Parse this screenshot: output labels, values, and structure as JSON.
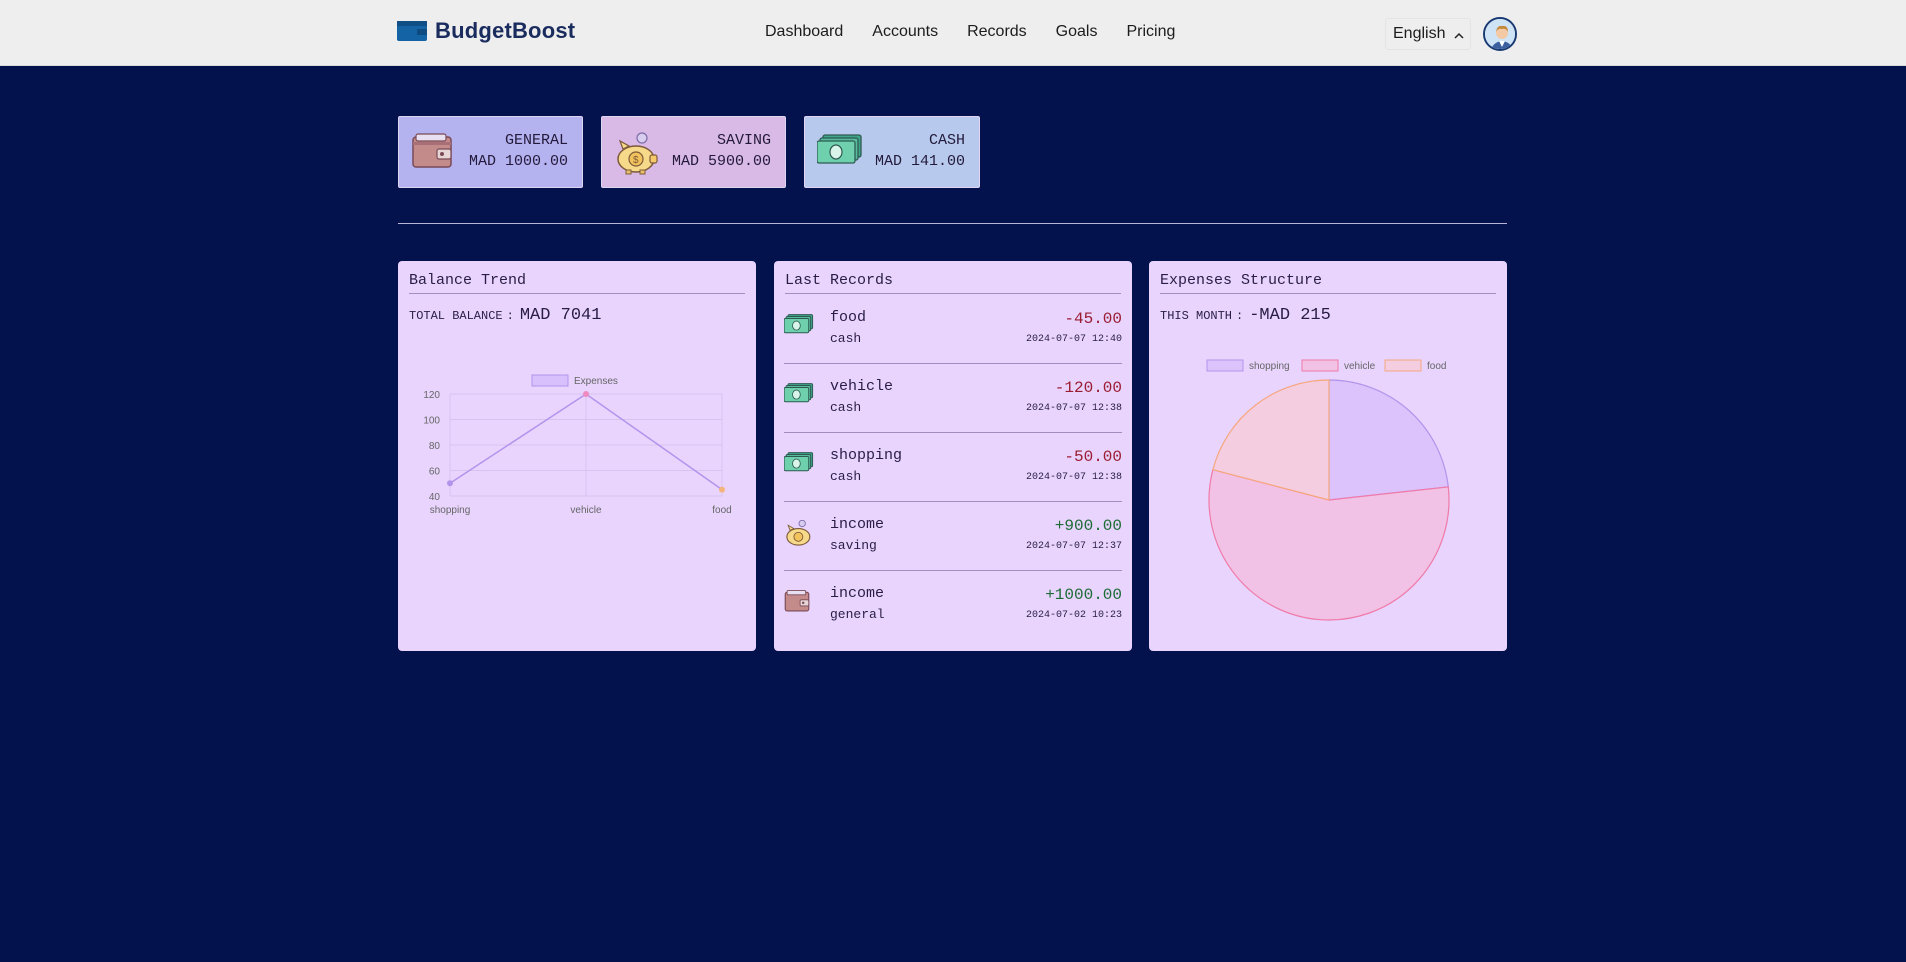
{
  "header": {
    "brand": "BudgetBoost",
    "nav": [
      "Dashboard",
      "Accounts",
      "Records",
      "Goals",
      "Pricing"
    ],
    "language": "English"
  },
  "accounts": [
    {
      "name": "GENERAL",
      "amount": "MAD 1000.00",
      "icon": "wallet-icon",
      "color": "#b5b3ef"
    },
    {
      "name": "SAVING",
      "amount": "MAD 5900.00",
      "icon": "piggy-bank-icon",
      "color": "#d9b9e6"
    },
    {
      "name": "CASH",
      "amount": "MAD 141.00",
      "icon": "cash-icon",
      "color": "#b7c9ec"
    }
  ],
  "balance_trend": {
    "title": "Balance Trend",
    "label": "TOTAL BALANCE",
    "value": "MAD 7041"
  },
  "last_records": {
    "title": "Last Records",
    "items": [
      {
        "category": "food",
        "account": "cash",
        "amount": "-45.00",
        "date": "2024-07-07 12:40",
        "icon": "cash-icon"
      },
      {
        "category": "vehicle",
        "account": "cash",
        "amount": "-120.00",
        "date": "2024-07-07 12:38",
        "icon": "cash-icon"
      },
      {
        "category": "shopping",
        "account": "cash",
        "amount": "-50.00",
        "date": "2024-07-07 12:38",
        "icon": "cash-icon"
      },
      {
        "category": "income",
        "account": "saving",
        "amount": "+900.00",
        "date": "2024-07-07 12:37",
        "icon": "piggy-bank-icon"
      },
      {
        "category": "income",
        "account": "general",
        "amount": "+1000.00",
        "date": "2024-07-02 10:23",
        "icon": "wallet-icon"
      }
    ]
  },
  "expenses_structure": {
    "title": "Expenses Structure",
    "label": "THIS MONTH",
    "value": "-MAD 215"
  },
  "chart_data": [
    {
      "type": "line",
      "categories": [
        "shopping",
        "vehicle",
        "food"
      ],
      "series": [
        {
          "name": "Expenses",
          "values": [
            50,
            120,
            45
          ]
        }
      ],
      "ylim": [
        40,
        120
      ],
      "yticks": [
        40,
        60,
        80,
        100,
        120
      ],
      "grid": true,
      "legend": "top",
      "colors": {
        "line": "#b394ec",
        "points": [
          "#b394ec",
          "#f08ac0",
          "#f5b37c"
        ]
      }
    },
    {
      "type": "pie",
      "categories": [
        "shopping",
        "vehicle",
        "food"
      ],
      "values": [
        50,
        120,
        45
      ],
      "legend": "top",
      "colors": {
        "fill": [
          "#dcc3fb",
          "#f1c1e6",
          "#f4cde0"
        ],
        "stroke": [
          "#b394ec",
          "#f07aa8",
          "#f6a77e"
        ]
      }
    }
  ]
}
